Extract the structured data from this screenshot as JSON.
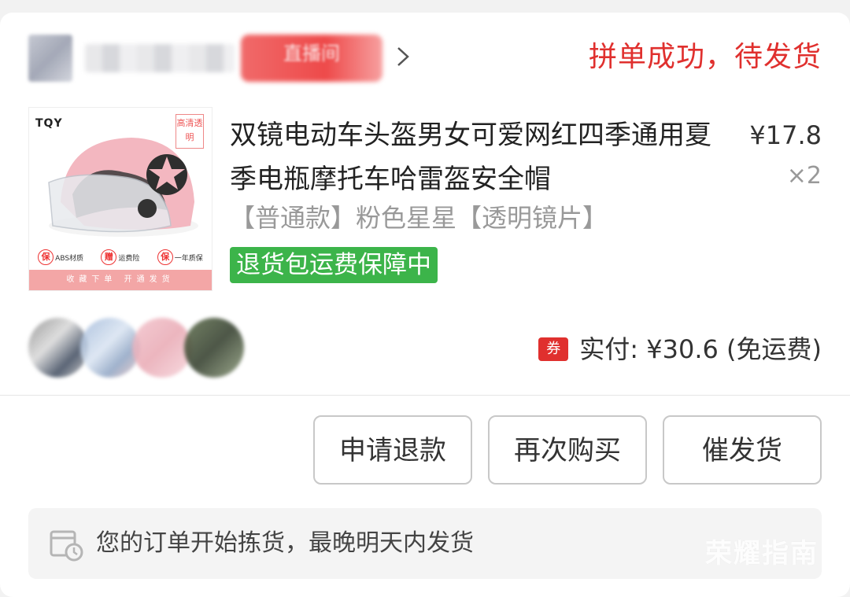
{
  "header": {
    "shop_name": "",
    "shop_tag": "直播间",
    "status": "拼单成功，待发货"
  },
  "product": {
    "image": {
      "brand": "TQY",
      "hd_badge": "高清透明",
      "badges": [
        {
          "mark": "保",
          "label": "ABS材质"
        },
        {
          "mark": "赠",
          "label": "运费险"
        },
        {
          "mark": "保",
          "label": "一年质保"
        }
      ],
      "footer": "收藏下单 开通发货"
    },
    "title": "双镜电动车头盔男女可爱网红四季通用夏季电瓶摩托车哈雷盔安全帽",
    "price": "¥17.8",
    "quantity": "×2",
    "spec": "【普通款】粉色星星【透明镜片】",
    "insurance_tag": "退货包运费保障中"
  },
  "summary": {
    "coupon_icon": "券",
    "paid_text": "实付: ¥30.6 (免运费)"
  },
  "actions": {
    "refund_label": "申请退款",
    "rebuy_label": "再次购买",
    "urge_label": "催发货"
  },
  "notice": {
    "text": "您的订单开始拣货，最晚明天内发货"
  },
  "watermark": "荣耀指南",
  "colors": {
    "status_red": "#e0302e",
    "insurance_green": "#3cb44a"
  }
}
